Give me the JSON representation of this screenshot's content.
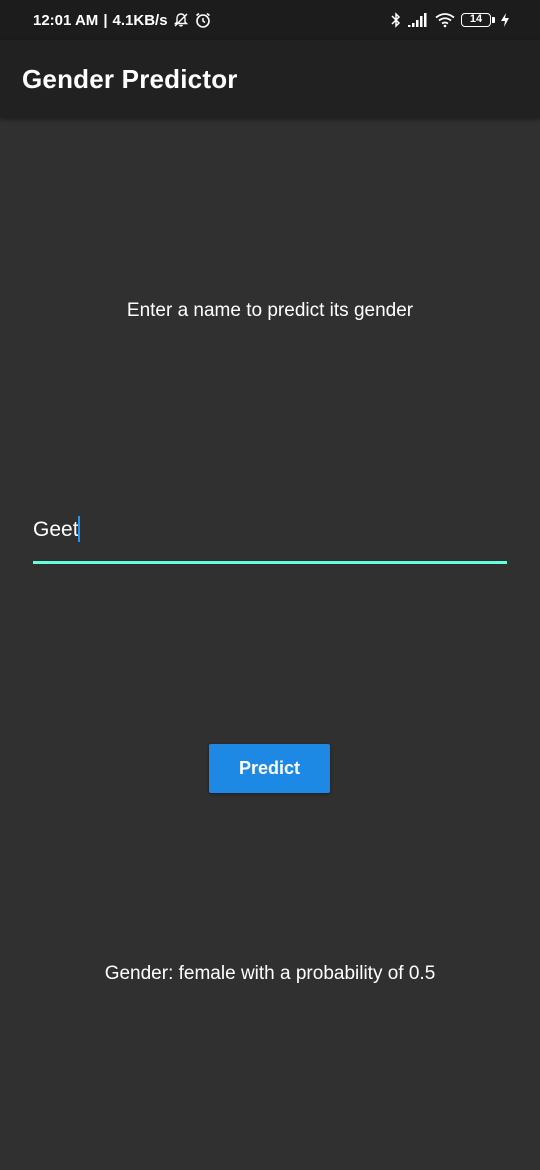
{
  "status_bar": {
    "time": "12:01 AM",
    "separator": "|",
    "network_speed": "4.1KB/s",
    "icons": [
      "bell-off-icon",
      "alarm-icon",
      "bluetooth-icon",
      "signal-icon",
      "wifi-icon",
      "battery-icon",
      "charging-icon"
    ],
    "battery_level": "14"
  },
  "app_bar": {
    "title": "Gender Predictor"
  },
  "main": {
    "prompt": "Enter a name to predict its gender",
    "name_input": {
      "value": "Geet",
      "underline_color": "#64ffda",
      "cursor_color": "#2196f3"
    },
    "predict_button": {
      "label": "Predict",
      "color": "#1e88e5"
    },
    "result": "Gender: female with a probability of 0.5"
  },
  "colors": {
    "background": "#303030",
    "app_bar": "#212121",
    "status_bar": "#1c1c1c",
    "text": "#ffffff"
  }
}
